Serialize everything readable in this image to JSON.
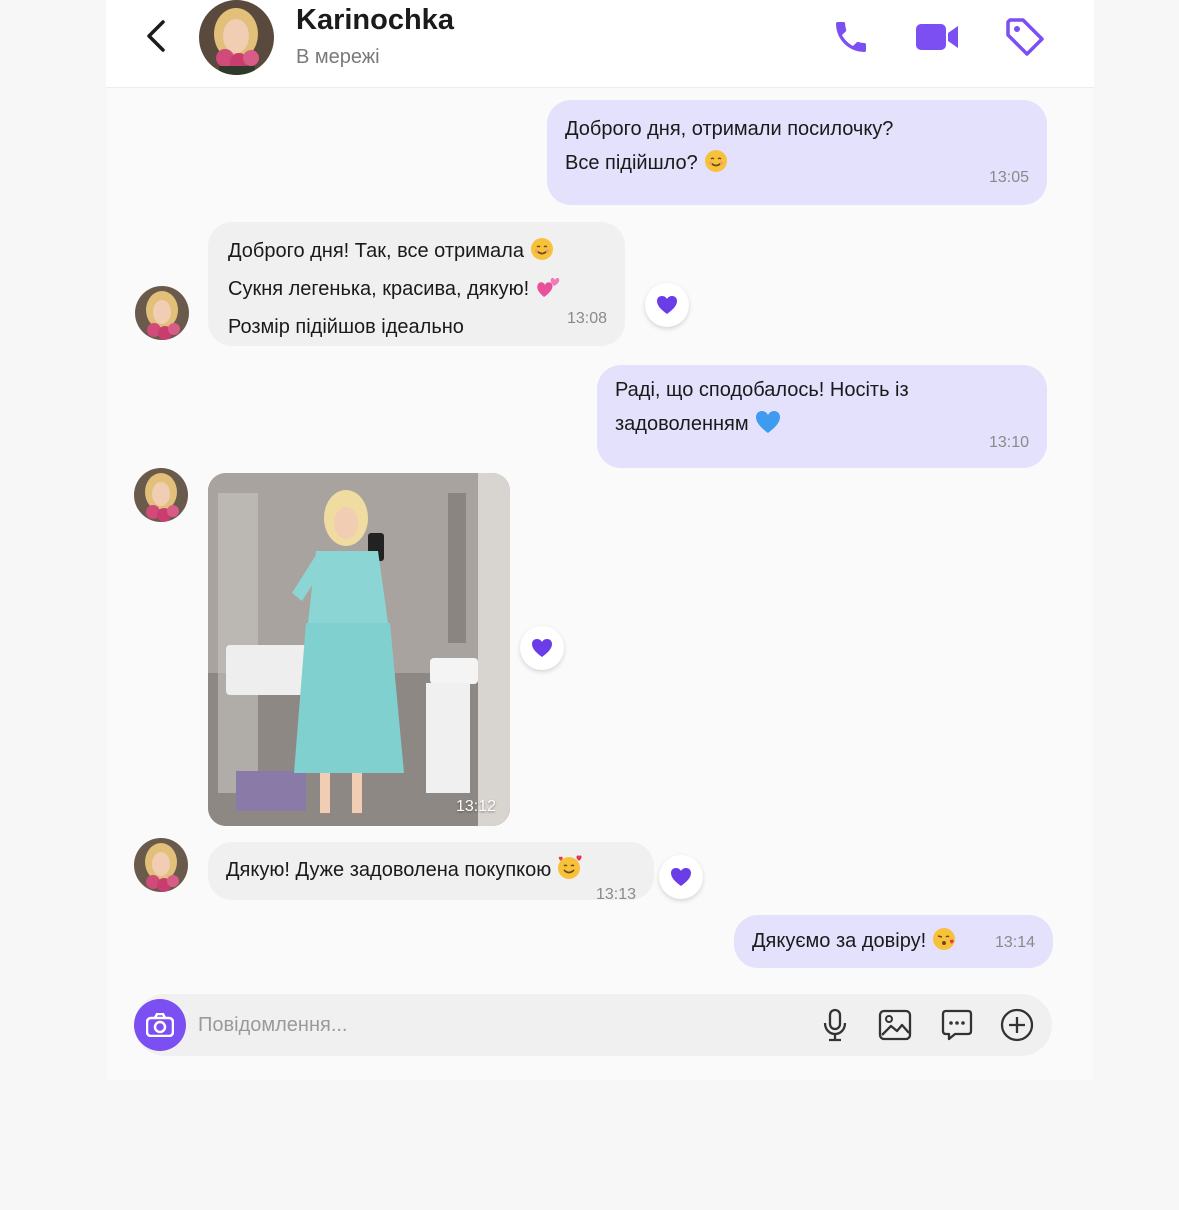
{
  "header": {
    "contact_name": "Karinochka",
    "status": "В мережі",
    "icons": [
      "back-icon",
      "phone-icon",
      "video-icon",
      "tag-icon"
    ]
  },
  "messages": [
    {
      "direction": "out",
      "lines": [
        "Доброго дня, отримали посилочку?",
        "Все підійшло?"
      ],
      "emoji": "smile",
      "time": "13:05"
    },
    {
      "direction": "in",
      "lines": [
        "Доброго дня! Так, все отримала",
        "Сукня легенька, красива, дякую!",
        "Розмір підійшов ідеально"
      ],
      "emoji": [
        "smile",
        "two-hearts"
      ],
      "time": "13:08",
      "reaction": "heart"
    },
    {
      "direction": "out",
      "lines": [
        "Раді, що сподобалось! Носіть із",
        "задоволенням"
      ],
      "emoji": "blue-heart",
      "time": "13:10"
    },
    {
      "direction": "in",
      "type": "photo",
      "time": "13:12",
      "reaction": "heart"
    },
    {
      "direction": "in",
      "lines": [
        "Дякую! Дуже задоволена покупкою"
      ],
      "emoji": "smiling-face-with-hearts",
      "time": "13:13",
      "reaction": "heart"
    },
    {
      "direction": "out",
      "lines": [
        "Дякуємо за довіру!"
      ],
      "emoji": "face-blowing-kiss",
      "time": "13:14"
    }
  ],
  "composer": {
    "placeholder": "Повідомлення...",
    "value": "",
    "icons": [
      "camera-icon",
      "microphone-icon",
      "gallery-icon",
      "sticker-icon",
      "plus-icon"
    ]
  },
  "colors": {
    "accent": "#7b4ff2",
    "outgoing_bubble": "#e3e1fb",
    "incoming_bubble": "#f0f0f0",
    "reaction_heart": "#6a3de8"
  }
}
